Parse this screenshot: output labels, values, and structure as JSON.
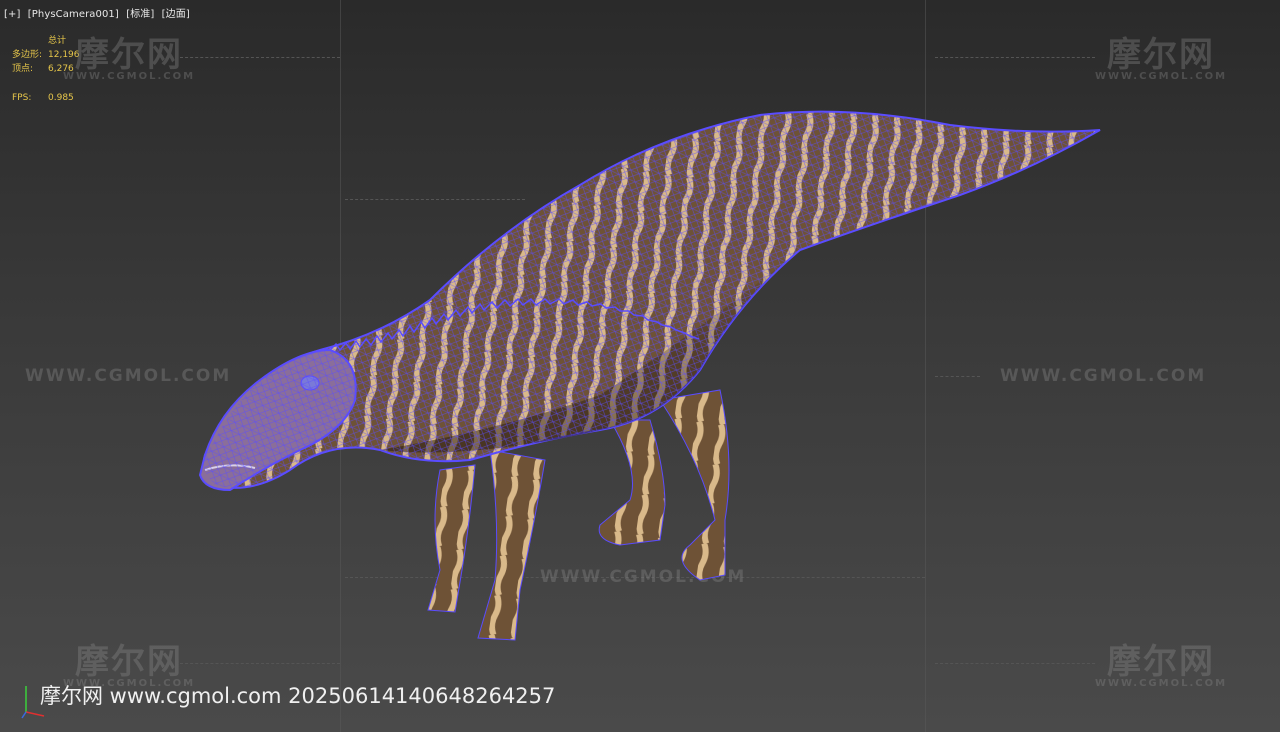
{
  "viewport": {
    "label_plus": "[+]",
    "label_camera": "[PhysCamera001]",
    "label_shading": "[标准]",
    "label_edges": "[边面]"
  },
  "stats": {
    "header": "总计",
    "polygons_label": "多边形:",
    "polygons_value": "12,196",
    "vertices_label": "顶点:",
    "vertices_value": "6,276",
    "fps_label": "FPS:",
    "fps_value": "0.985"
  },
  "watermarks": {
    "logo_cn": "摩尔网",
    "logo_en": "WWW.CGMOL.COM",
    "url": "WWW.CGMOL.COM"
  },
  "bottom_watermark": "摩尔网 www.cgmol.com 20250614140648264257",
  "colors": {
    "wire": "#5a4cff",
    "body": "#8a6a4a",
    "stripe": "#d9b98a",
    "stats": "#e6c64a"
  },
  "icons": [
    "axis-gizmo-icon"
  ]
}
